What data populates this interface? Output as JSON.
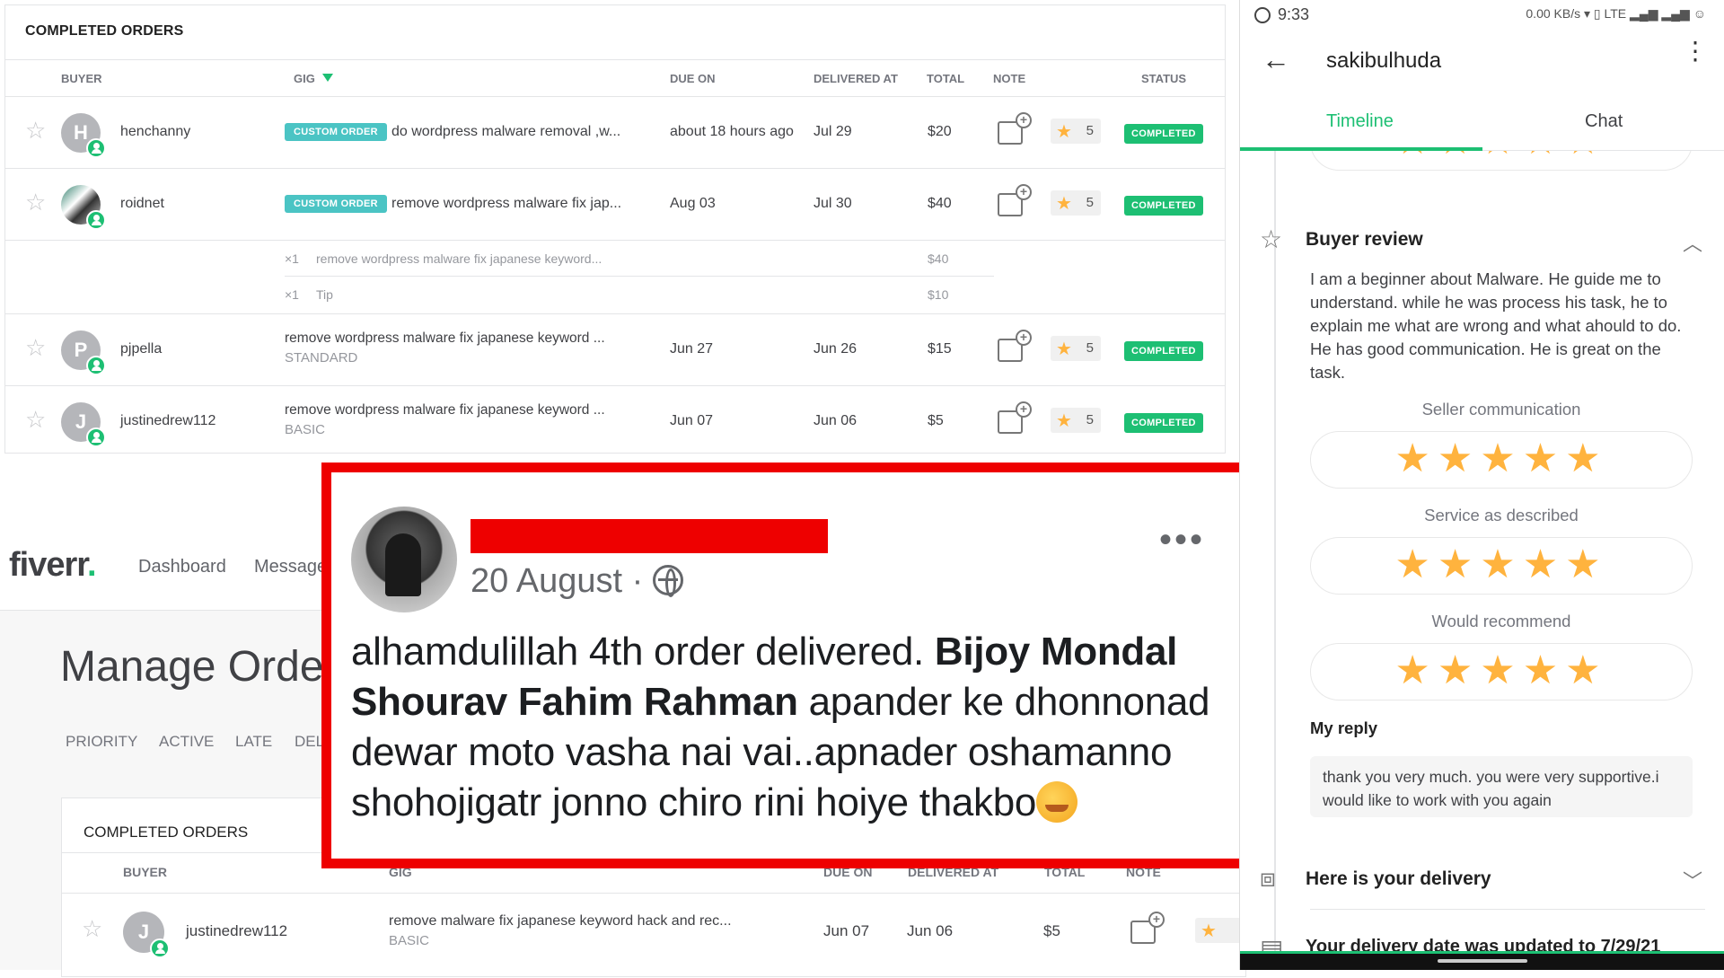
{
  "top_table": {
    "title": "COMPLETED ORDERS",
    "headers": {
      "buyer": "BUYER",
      "gig": "GIG",
      "due": "DUE ON",
      "delivered": "DELIVERED AT",
      "total": "TOTAL",
      "note": "NOTE",
      "status": "STATUS"
    },
    "rows": [
      {
        "avatar": "H",
        "buyer": "henchanny",
        "tag": "CUSTOM ORDER",
        "gig": "do wordpress malware removal ,w...",
        "due": "about 18 hours ago",
        "delivered": "Jul 29",
        "total": "$20",
        "rating": "5",
        "status": "COMPLETED"
      },
      {
        "avatar": "",
        "buyer": "roidnet",
        "tag": "CUSTOM ORDER",
        "gig": "remove wordpress malware fix jap...",
        "due": "Aug 03",
        "delivered": "Jul 30",
        "total": "$40",
        "rating": "5",
        "status": "COMPLETED"
      },
      {
        "avatar": "P",
        "buyer": "pjpella",
        "package": "STANDARD",
        "gig": "remove wordpress malware fix japanese keyword ...",
        "due": "Jun 27",
        "delivered": "Jun 26",
        "total": "$15",
        "rating": "5",
        "status": "COMPLETED"
      },
      {
        "avatar": "J",
        "buyer": "justinedrew112",
        "package": "BASIC",
        "gig": "remove wordpress malware fix japanese keyword ...",
        "due": "Jun 07",
        "delivered": "Jun 06",
        "total": "$5",
        "rating": "5",
        "status": "COMPLETED"
      }
    ],
    "subitems": [
      {
        "qty": "×1",
        "label": "remove wordpress malware fix japanese keyword...",
        "amount": "$40"
      },
      {
        "qty": "×1",
        "label": "Tip",
        "amount": "$10"
      }
    ]
  },
  "fiverr": {
    "logo": "fiverr",
    "logo_dot": ".",
    "nav": [
      "Dashboard",
      "Message"
    ],
    "page_title": "Manage Orde",
    "tabs": [
      "PRIORITY",
      "ACTIVE",
      "LATE",
      "DEL"
    ],
    "card_title": "COMPLETED ORDERS",
    "headers": {
      "buyer": "BUYER",
      "gig": "GIG",
      "due": "DUE ON",
      "delivered": "DELIVERED AT",
      "total": "TOTAL",
      "note": "NOTE"
    },
    "row": {
      "avatar": "J",
      "buyer": "justinedrew112",
      "gig": "remove malware fix japanese keyword hack and rec...",
      "package": "BASIC",
      "due": "Jun 07",
      "delivered": "Jun 06",
      "total": "$5"
    }
  },
  "facebook_post": {
    "date": "20 August ·",
    "dots": "•••",
    "text_1": "alhamdulillah 4th order delivered. ",
    "bold_names": "Bijoy Mondal Shourav Fahim Rahman",
    "text_2": " apander ke dhonnonad dewar moto vasha nai vai..apnader oshamanno shohojigatr jonno chiro rini hoiye thakbo",
    "highlight_color": "#ee0000"
  },
  "phone": {
    "time": "9:33",
    "status_right": "0.00 KB/s ▾ ▯ LTE ▂▄▆ ▂▄▆ ☺",
    "username": "sakibulhuda",
    "tabs": [
      "Timeline",
      "Chat"
    ],
    "buyer_review_title": "Buyer review",
    "review_text": "I am a beginner about Malware. He guide me to understand. while he was process his task, he to explain me what are wrong and what ahould to do. He has good communication. He is great on the task.",
    "criteria": [
      {
        "label": "Seller communication",
        "stars": "★★★★★"
      },
      {
        "label": "Service as described",
        "stars": "★★★★★"
      },
      {
        "label": "Would recommend",
        "stars": "★★★★★"
      }
    ],
    "my_reply_label": "My reply",
    "reply_text": "thank you very much. you were very supportive.i would like to work with you again",
    "delivery_title": "Here is your delivery",
    "delivery_update": "Your delivery date was updated to 7/29/21",
    "accent": "#1dbf73"
  }
}
